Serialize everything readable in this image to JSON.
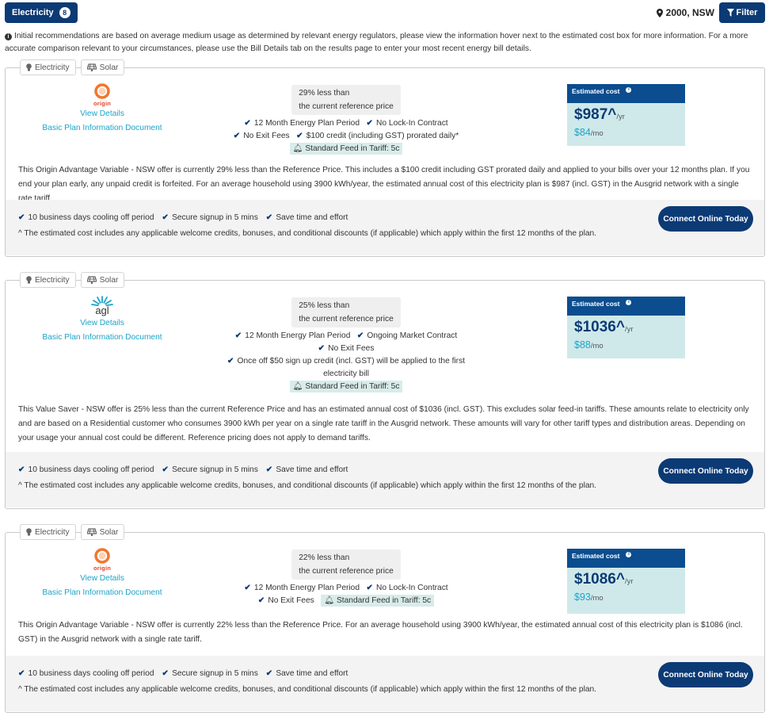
{
  "topbar": {
    "category_label": "Electricity",
    "category_count": "8",
    "location": "2000, NSW",
    "filter_label": "Filter"
  },
  "info_note": "Initial recommendations are based on average medium usage as determined by relevant energy regulators, please view the information hover next to the estimated cost box for more information. For a more accurate comparison relevant to your circumstances, please use the Bill Details tab on the results page to enter your most recent energy bill details.",
  "tags": {
    "electricity": "Electricity",
    "solar": "Solar"
  },
  "common": {
    "view_details": "View Details",
    "basic_plan_doc": "Basic Plan Information Document",
    "est_cost_label": "Estimated cost",
    "per_year": "/yr",
    "per_month": "/mo",
    "reference_text": "the current reference price",
    "feed_in": "Standard Feed in Tariff: 5c",
    "benefits": [
      "10 business days cooling off period",
      "Secure signup in 5 mins",
      "Save time and effort"
    ],
    "footnote": "^ The estimated cost includes any applicable welcome credits, bonuses, and conditional discounts (if applicable) which apply within the first 12 months of the plan.",
    "cta": "Connect Online Today"
  },
  "plans": [
    {
      "logo_word": "origin",
      "pct_text": "29% less than",
      "features": [
        "12 Month Energy Plan Period",
        "No Lock-In Contract",
        "No Exit Fees",
        "$100 credit (including GST) prorated daily*"
      ],
      "cost_year": "$987^",
      "cost_month": "$84",
      "description": "This Origin Advantage Variable - NSW offer is currently 29% less than the Reference Price. This includes a $100 credit including GST prorated daily and applied to your bills over your 12 months plan. If you end your plan early, any unpaid credit is forfeited. For an average household using 3900 kWh/year, the estimated annual cost of this electricity plan is $987 (incl. GST) in the Ausgrid network with a single rate tariff."
    },
    {
      "logo_word": "agl",
      "pct_text": "25% less than",
      "features": [
        "12 Month Energy Plan Period",
        "Ongoing Market Contract",
        "No Exit Fees",
        "Once off $50 sign up credit (incl. GST) will be applied to the first",
        "electricity bill"
      ],
      "cost_year": "$1036^",
      "cost_month": "$88",
      "description": "This Value Saver - NSW offer is 25% less than the current Reference Price and has an estimated annual cost of $1036 (incl. GST). This excludes solar feed-in tariffs. These amounts relate to electricity only and are based on a Residential customer who consumes 3900 kWh per year on a single rate tariff in the Ausgrid network. These amounts will vary for other tariff types and distribution areas. Depending on your usage your annual cost could be different. Reference pricing does not apply to demand tariffs."
    },
    {
      "logo_word": "origin",
      "pct_text": "22% less than",
      "features": [
        "12 Month Energy Plan Period",
        "No Lock-In Contract",
        "No Exit Fees"
      ],
      "cost_year": "$1086^",
      "cost_month": "$93",
      "description": "This Origin Advantage Variable - NSW offer is currently 22% less than the Reference Price. For an average household using 3900 kWh/year, the estimated annual cost of this electricity plan is $1086 (incl. GST) in the Ausgrid network with a single rate tariff."
    }
  ],
  "colors": {
    "navy": "#0b3a75",
    "teal_link": "#1ca4c8",
    "cost_bg": "#cfe9ea",
    "origin_orange": "#e8432a"
  }
}
